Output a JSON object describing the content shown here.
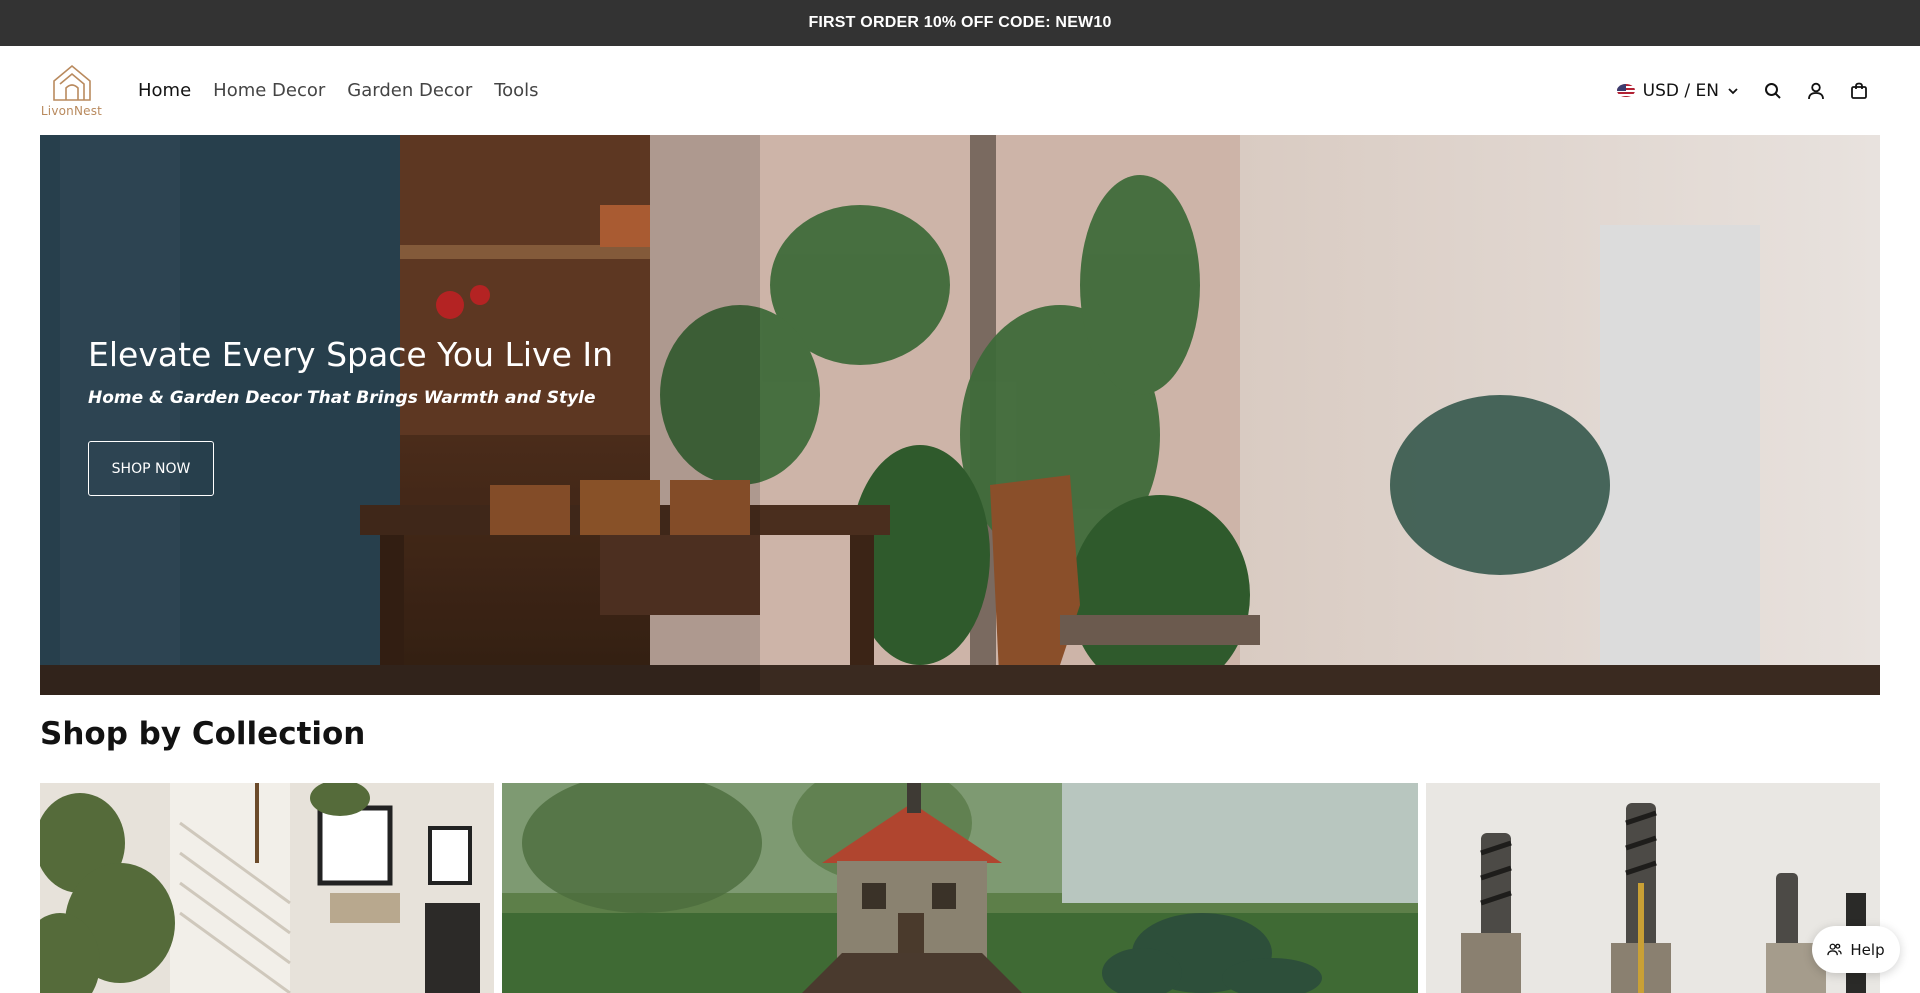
{
  "announcement": {
    "text": "FIRST ORDER 10% OFF CODE: NEW10"
  },
  "brand": {
    "name": "LivonNest",
    "accent": "#b98a5e"
  },
  "nav": {
    "items": [
      {
        "label": "Home",
        "active": true
      },
      {
        "label": "Home Decor",
        "active": false
      },
      {
        "label": "Garden Decor",
        "active": false
      },
      {
        "label": "Tools",
        "active": false
      }
    ]
  },
  "header": {
    "locale_label": "USD / EN",
    "icons": [
      "search-icon",
      "account-icon",
      "cart-icon"
    ]
  },
  "hero": {
    "title": "Elevate Every Space You Live In",
    "subtitle": "Home & Garden Decor That Brings Warmth and Style",
    "cta_label": "SHOP NOW"
  },
  "collections": {
    "title": "Shop by Collection",
    "items": [
      {
        "image": "home-decor-wall-image"
      },
      {
        "image": "garden-birdhouse-image"
      },
      {
        "image": "tools-drill-bits-image"
      }
    ]
  },
  "help": {
    "label": "Help"
  }
}
